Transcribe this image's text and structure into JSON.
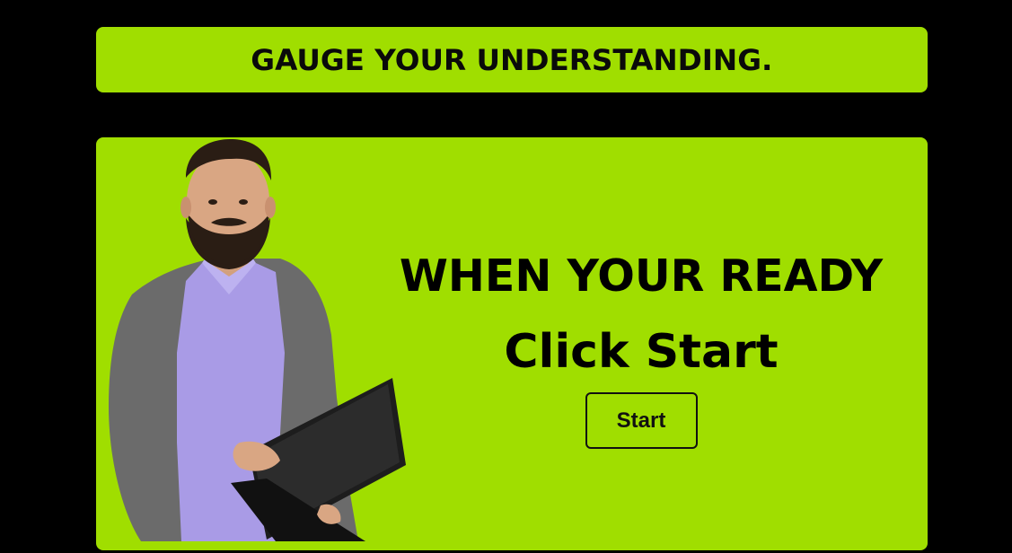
{
  "banner": {
    "title": "GAUGE YOUR UNDERSTANDING."
  },
  "card": {
    "heading": "WHEN YOUR READY",
    "subheading": "Click Start",
    "start_label": "Start",
    "image": "man-holding-laptop-illustration"
  },
  "colors": {
    "background": "#000000",
    "accent_green": "#a0de00",
    "text": "#000000"
  }
}
